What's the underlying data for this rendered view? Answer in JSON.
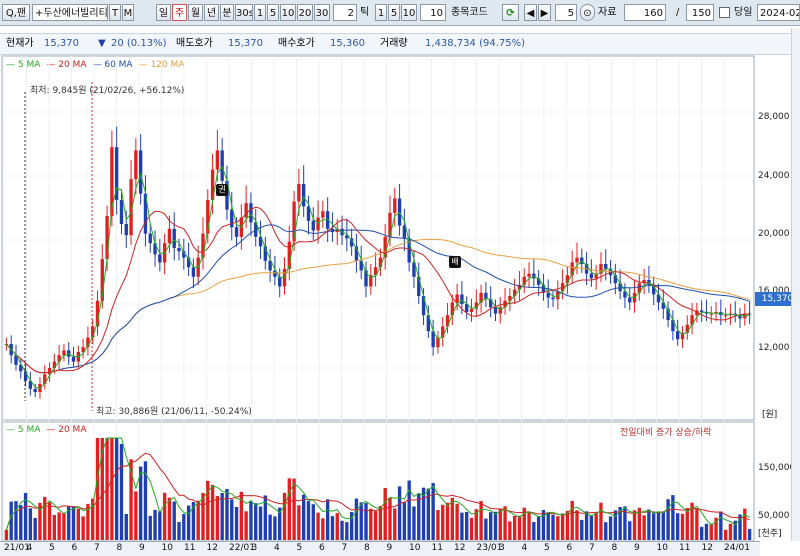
{
  "toolbar": {
    "search_label": "Q,팬",
    "symbol": "+두산에너빌리티",
    "btn_t": "T",
    "btn_m": "M",
    "periods": [
      "일",
      "주",
      "월",
      "년",
      "분",
      "30s",
      "1",
      "5",
      "10",
      "20",
      "30"
    ],
    "active_period": "주",
    "minute_input": "2",
    "tick_label": "틱",
    "ticks": [
      "1",
      "5",
      "10"
    ],
    "tick_input": "10",
    "code_label": "종목코드",
    "step_input": "5",
    "data_label": "자료",
    "data_count": "160",
    "slash": "/",
    "total_count": "150",
    "today_label": "당일",
    "date": "2024-02"
  },
  "info": {
    "price_label": "현재가",
    "price": "15,370",
    "change_arrow": "▼",
    "change": "20 (0.13%)",
    "ask_label": "매도호가",
    "ask": "15,370",
    "bid_label": "매수호가",
    "bid": "15,360",
    "volume_label": "거래량",
    "volume": "1,438,734 (94.75%)"
  },
  "legend_price": [
    {
      "label": "5 MA",
      "color": "#22aa22"
    },
    {
      "label": "20 MA",
      "color": "#cc2222"
    },
    {
      "label": "60 MA",
      "color": "#1f4fb0"
    },
    {
      "label": "120 MA",
      "color": "#e8a040"
    }
  ],
  "legend_volume": [
    {
      "label": "5 MA",
      "color": "#22aa22"
    },
    {
      "label": "20 MA",
      "color": "#cc2222"
    }
  ],
  "annotations": {
    "low": "최저: 9,845원 (21/02/26, +56.12%)",
    "high": "최고: 30,886원 (21/06/11, -50.24%)",
    "marker1": "권",
    "marker2": "배",
    "volume_note": "전일대비 증가 상승/하락"
  },
  "y_price_ticks": [
    "28,000",
    "24,000",
    "20,000",
    "16,000",
    "12,000"
  ],
  "current_price_tag": "15,370",
  "y_unit_price": "[원]",
  "y_volume_ticks": [
    "150,000",
    "100,000",
    "50,000"
  ],
  "y_unit_volume": "[천주]",
  "x_labels": [
    "21/01",
    "4",
    "5",
    "6",
    "7",
    "8",
    "9",
    "10",
    "11",
    "12",
    "22/01",
    "3",
    "4",
    "5",
    "6",
    "7",
    "8",
    "9",
    "10",
    "11",
    "12",
    "23/01",
    "3",
    "4",
    "5",
    "6",
    "7",
    "8",
    "9",
    "10",
    "11",
    "12",
    "24/01"
  ],
  "colors": {
    "up": "#e02020",
    "down": "#1f3fb0",
    "ma5": "#22aa22",
    "ma20": "#cc2222",
    "ma60": "#1f4fb0",
    "ma120": "#e8a040"
  },
  "chart_data": {
    "type": "candlestick",
    "y_range": [
      9000,
      31000
    ],
    "weekly_close": [
      13500,
      12800,
      12200,
      11800,
      11200,
      10700,
      10500,
      11000,
      11600,
      12000,
      12400,
      12800,
      13100,
      12700,
      12400,
      13000,
      13300,
      13900,
      14600,
      16200,
      18800,
      21500,
      25800,
      22500,
      21000,
      20300,
      23800,
      25600,
      22900,
      20400,
      19800,
      19100,
      18600,
      19800,
      20700,
      19500,
      19300,
      18900,
      18300,
      17700,
      18900,
      20400,
      22500,
      24400,
      25600,
      23700,
      21900,
      20800,
      20200,
      21400,
      22300,
      21100,
      20200,
      19600,
      18700,
      18100,
      17700,
      17100,
      18200,
      19900,
      22400,
      23500,
      22100,
      21200,
      20600,
      21400,
      21800,
      20700,
      20500,
      20700,
      20300,
      20100,
      19600,
      18700,
      18100,
      17100,
      17800,
      18300,
      18900,
      20200,
      21700,
      22600,
      20900,
      20100,
      18600,
      17700,
      16500,
      15300,
      14300,
      13300,
      13900,
      14600,
      15300,
      16100,
      16600,
      16000,
      15500,
      15700,
      16100,
      16700,
      16300,
      15800,
      15400,
      15800,
      16200,
      16500,
      16900,
      17200,
      17700,
      17900,
      17600,
      17200,
      16700,
      16400,
      16300,
      16800,
      17300,
      17800,
      18600,
      18900,
      18500,
      17900,
      17600,
      17900,
      18500,
      18200,
      17800,
      17300,
      16800,
      16400,
      16100,
      16700,
      17300,
      17500,
      17200,
      16600,
      16100,
      15700,
      15000,
      14300,
      13800,
      14200,
      14700,
      15300,
      15600,
      15500,
      15400,
      15400,
      15500,
      15300,
      15300,
      15400,
      15300,
      15100,
      15400,
      15370
    ],
    "ma_series": [
      "5 MA",
      "20 MA",
      "60 MA",
      "120 MA"
    ]
  }
}
